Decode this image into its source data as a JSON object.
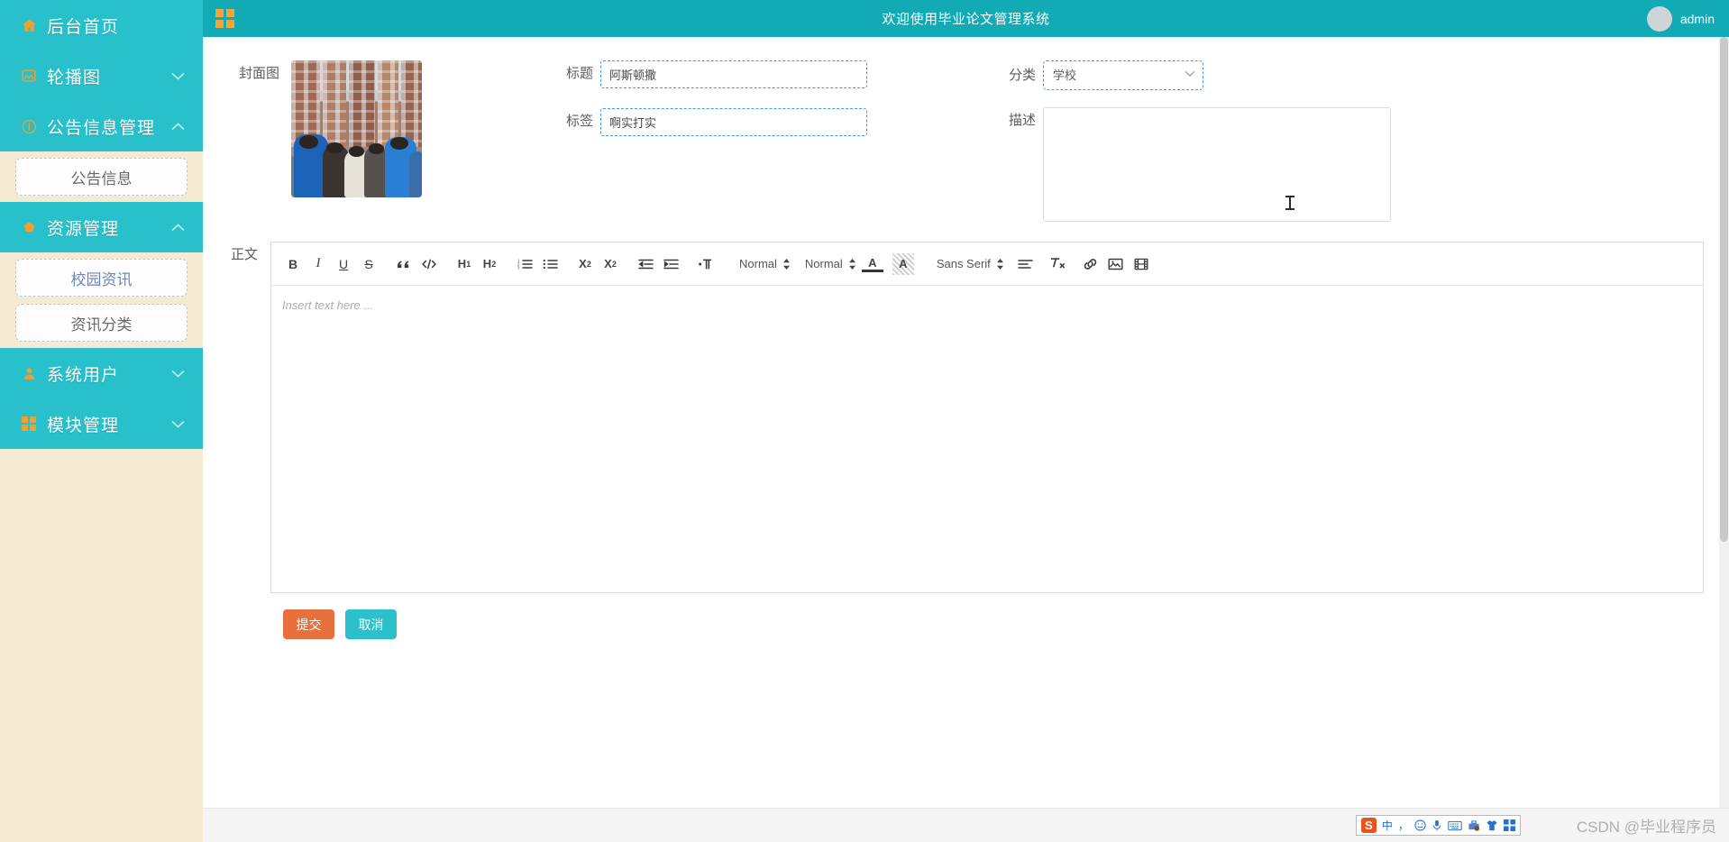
{
  "topbar": {
    "menu_icon": "grid-squares-icon",
    "title": "欢迎使用毕业论文管理系统",
    "username": "admin",
    "avatar": "user-avatar"
  },
  "sidebar": {
    "items": [
      {
        "label": "后台首页",
        "icon": "home-icon",
        "expandable": false,
        "chevron": ""
      },
      {
        "label": "轮播图",
        "icon": "image-icon",
        "expandable": true,
        "chevron": "⌄"
      },
      {
        "label": "公告信息管理",
        "icon": "info-circle-icon",
        "expandable": true,
        "chevron": "⌃",
        "children": [
          {
            "label": "公告信息",
            "active": false
          }
        ]
      },
      {
        "label": "资源管理",
        "icon": "pentagon-icon",
        "expandable": true,
        "chevron": "⌃",
        "children": [
          {
            "label": "校园资讯",
            "active": true
          },
          {
            "label": "资讯分类",
            "active": false
          }
        ]
      },
      {
        "label": "系统用户",
        "icon": "user-icon",
        "expandable": true,
        "chevron": "⌄"
      },
      {
        "label": "模块管理",
        "icon": "grid-icon",
        "expandable": true,
        "chevron": "⌄"
      }
    ]
  },
  "form": {
    "cover_label": "封面图",
    "cover_alt": "校园活动合影封面图",
    "title_label": "标题",
    "title_value": "阿斯顿撒",
    "title_placeholder": "",
    "tag_label": "标签",
    "tag_value": "啊实打实",
    "tag_placeholder": "",
    "category_label": "分类",
    "category_value": "学校",
    "category_options": [
      "学校"
    ],
    "desc_label": "描述",
    "desc_value": "",
    "desc_placeholder": ""
  },
  "editor": {
    "label": "正文",
    "placeholder": "Insert text here ...",
    "body_value": "",
    "toolbar": {
      "bold": "B",
      "italic": "I",
      "underline": "U",
      "strike": "S",
      "blockquote": "blockquote-icon",
      "codeblock": "code-icon",
      "h1": "H1",
      "h2": "H2",
      "ordered_list": "ordered-list-icon",
      "bullet_list": "bullet-list-icon",
      "subscript": "X2",
      "superscript": "X2",
      "outdent": "outdent-icon",
      "indent": "indent-icon",
      "direction": "text-direction-icon",
      "size_value": "Normal",
      "header_value": "Normal",
      "font_value": "Sans Serif",
      "text_color": "A",
      "background_color": "A",
      "align": "align-icon",
      "clear_format": "clear-format-icon",
      "link": "link-icon",
      "image": "image-icon",
      "video": "video-icon"
    }
  },
  "actions": {
    "submit": "提交",
    "cancel": "取消"
  },
  "statusbar": {
    "ime": {
      "logo": "S",
      "mode": "中",
      "punct": "，",
      "emoji": "☺",
      "mic": "mic-icon",
      "keyboard": "keyboard-icon",
      "toolbox": "toolbox-icon",
      "skin": "skin-icon",
      "apps": "apps-icon"
    },
    "watermark": "CSDN @毕业程序员"
  },
  "colors": {
    "sidebar_bg": "#f5ead2",
    "nav_bg": "#27c0cb",
    "topbar_bg": "#12aab5",
    "accent_orange": "#f0a030",
    "submit": "#e8703e",
    "cancel": "#2cc0cc",
    "input_border": "#3c9fe0"
  }
}
